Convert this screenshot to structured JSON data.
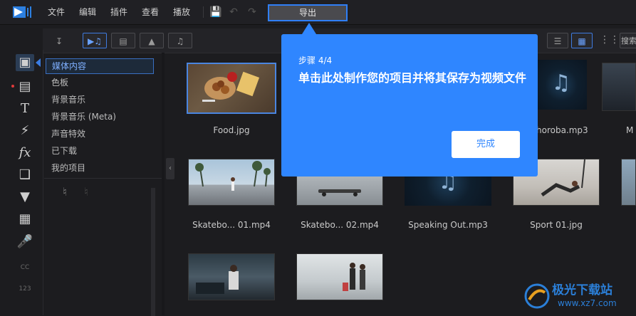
{
  "menu": {
    "items": [
      "文件",
      "编辑",
      "插件",
      "查看",
      "播放"
    ],
    "export_label": "导出"
  },
  "library": {
    "search_label": "搜索",
    "categories": [
      "媒体内容",
      "色板",
      "背景音乐",
      "背景音乐 (Meta)",
      "声音特效",
      "已下载",
      "我的项目"
    ]
  },
  "grid": {
    "items": [
      {
        "caption": "Food.jpg",
        "kind": "image"
      },
      {
        "caption": "Skatebo... 01.mp4",
        "kind": "video"
      },
      {
        "caption": "Skatebo... 02.mp4",
        "kind": "video"
      },
      {
        "caption": "Speaking Out.mp3",
        "kind": "audio"
      },
      {
        "caption": "Sport 01.jpg",
        "kind": "image"
      },
      {
        "caption": "horoba.mp3",
        "kind": "audio"
      },
      {
        "caption": "M",
        "kind": "image"
      }
    ]
  },
  "tooltip": {
    "step": "步骤 4/4",
    "body": "单击此处制作您的项目并将其保存为视频文件",
    "done_label": "完成"
  },
  "watermark": {
    "name": "极光下载站",
    "url": "www.xz7.com"
  },
  "colors": {
    "accent": "#2f86ff",
    "selection": "#4a85e0"
  }
}
